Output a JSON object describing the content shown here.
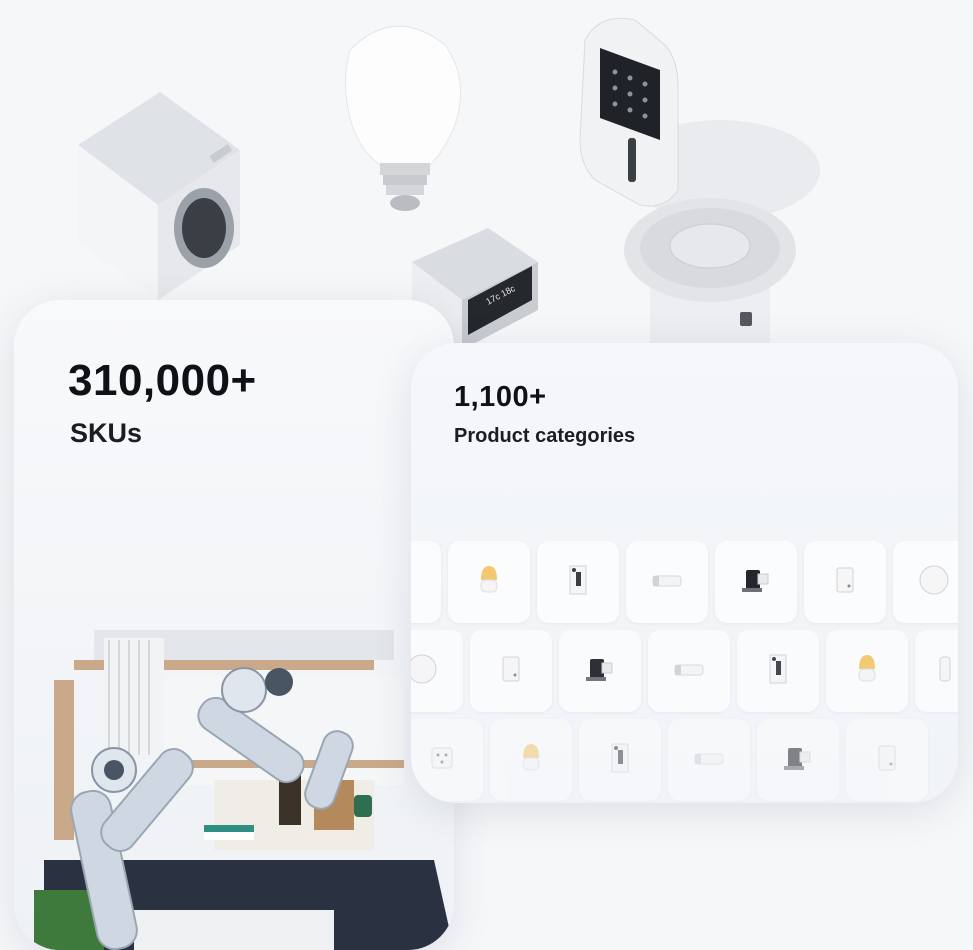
{
  "stats": {
    "skus": {
      "value": "310,000+",
      "label": "SKUs"
    },
    "categories": {
      "value": "1,100+",
      "label": "Product categories"
    }
  },
  "devices": [
    "washing-machine-icon",
    "smart-bulb-icon",
    "smart-lock-icon",
    "thermostat-icon",
    "smart-speaker-icon"
  ],
  "category_tiles": {
    "row1": [
      "partial-icon",
      "night-light-icon",
      "switch-panel-icon",
      "light-bar-icon",
      "camera-icon",
      "sensor-icon",
      "hub-icon"
    ],
    "row2": [
      "hub-icon",
      "sensor-icon",
      "camera-icon",
      "light-bar-icon",
      "switch-panel-icon",
      "night-light-icon",
      "partial-icon"
    ],
    "row3": [
      "socket-icon",
      "night-light-icon",
      "switch-panel-icon",
      "light-bar-icon",
      "camera-icon",
      "sensor-icon"
    ]
  },
  "colors": {
    "accent_warm": "#f3c870",
    "dark": "#1a1d22",
    "robot_blue": "#c9d4de"
  }
}
